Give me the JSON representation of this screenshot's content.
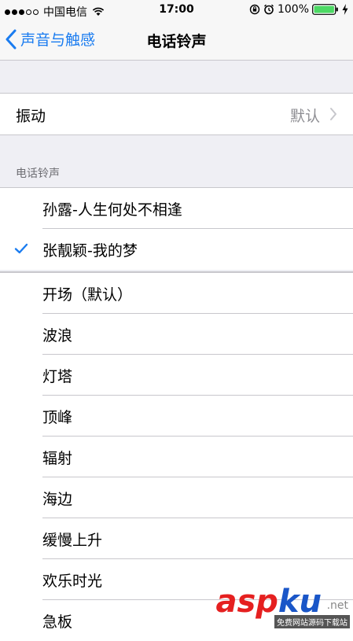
{
  "statusbar": {
    "carrier": "中国电信",
    "time": "17:00",
    "battery": "100%"
  },
  "navbar": {
    "back_label": "声音与触感",
    "title": "电话铃声"
  },
  "vibration": {
    "label": "振动",
    "value": "默认"
  },
  "section_header": "电话铃声",
  "custom_ringtones": [
    {
      "label": "孙露-人生何处不相逢",
      "selected": false
    },
    {
      "label": "张靓颖-我的梦",
      "selected": true
    }
  ],
  "ringtones": [
    {
      "label": "开场（默认）"
    },
    {
      "label": "波浪"
    },
    {
      "label": "灯塔"
    },
    {
      "label": "顶峰"
    },
    {
      "label": "辐射"
    },
    {
      "label": "海边"
    },
    {
      "label": "缓慢上升"
    },
    {
      "label": "欢乐时光"
    },
    {
      "label": "急板"
    }
  ],
  "watermark": {
    "asp": "asp",
    "ku": "ku",
    "net": ".net",
    "sub": "免费网站源码下载站"
  },
  "colors": {
    "accent": "#1a7cf0",
    "background": "#efeff4"
  }
}
